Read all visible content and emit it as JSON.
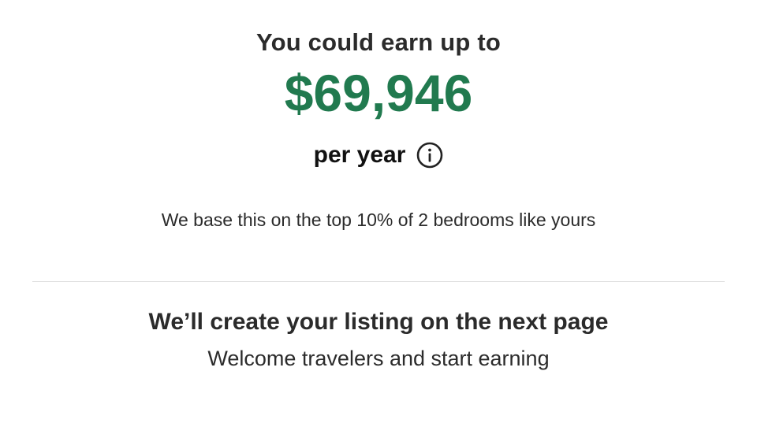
{
  "earnings": {
    "heading": "You could earn up to",
    "amount": "$69,946",
    "period": "per year",
    "info_icon": "info-circle-icon",
    "basis": "We base this on the top 10% of 2 bedrooms like yours"
  },
  "next_step": {
    "heading": "We’ll create your listing on the next page",
    "subtext": "Welcome travelers and start earning"
  },
  "colors": {
    "amount": "#217a4f",
    "text": "#2b2b2b",
    "divider": "#dddddd"
  }
}
